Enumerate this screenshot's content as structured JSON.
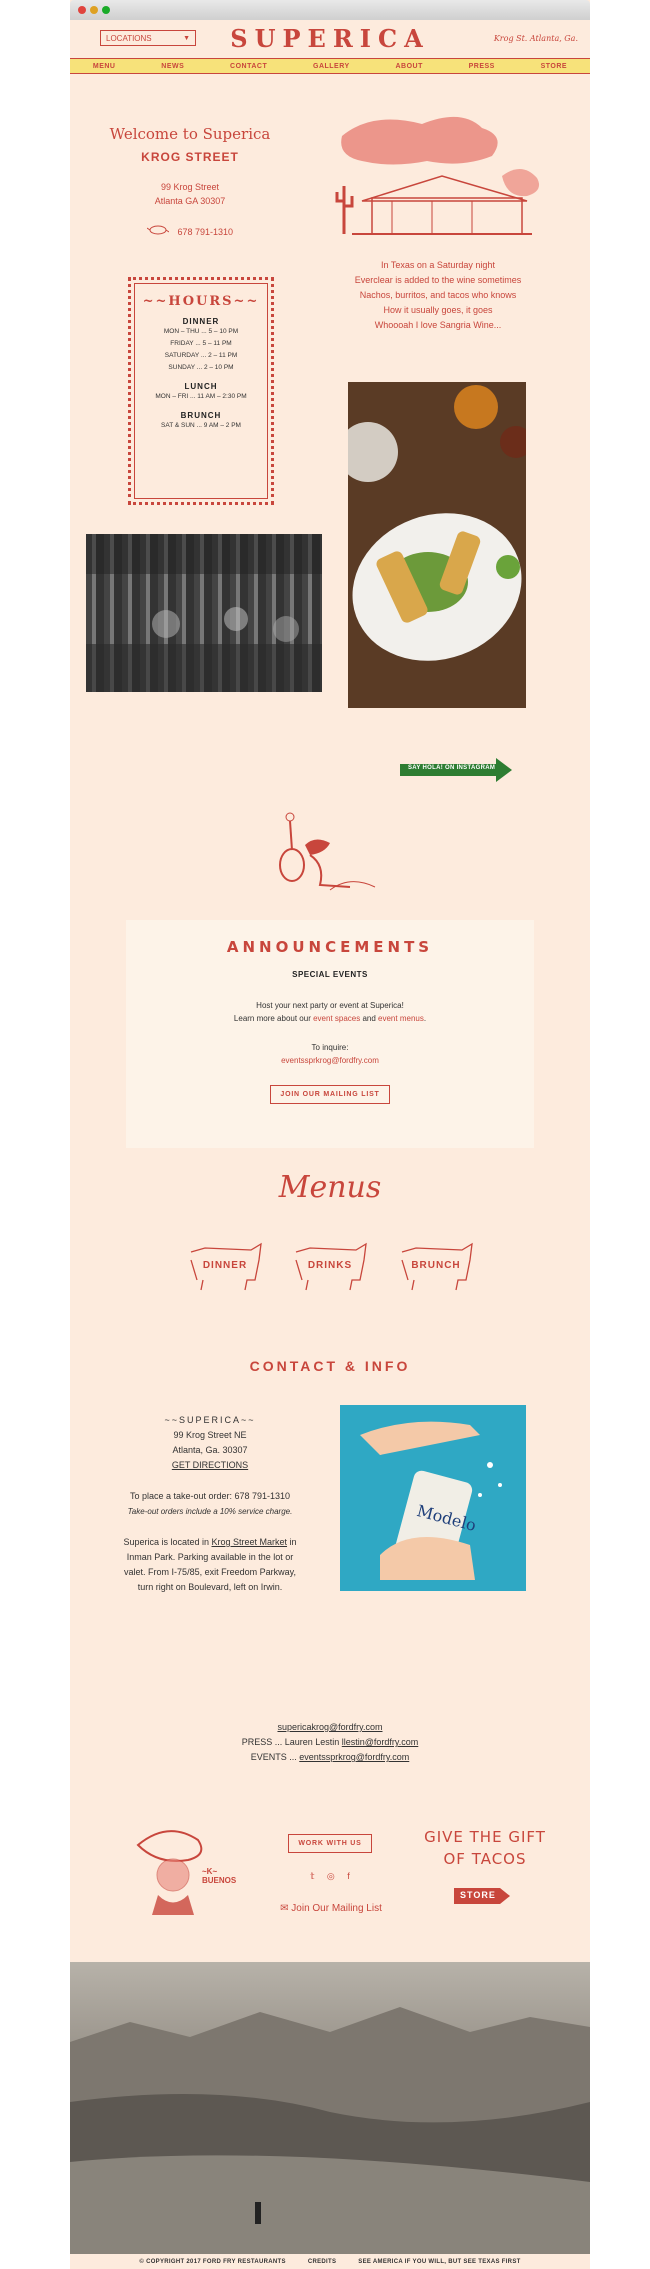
{
  "header": {
    "locations_label": "LOCATIONS",
    "logo": "SUPERICA",
    "tagline": "Krog St. Atlanta, Ga.",
    "nav": [
      "MENU",
      "NEWS",
      "CONTACT",
      "GALLERY",
      "ABOUT",
      "PRESS",
      "STORE"
    ]
  },
  "intro": {
    "welcome": "Welcome to Superica",
    "location": "KROG STREET",
    "address_line1": "99 Krog Street",
    "address_line2": "Atlanta GA 30307",
    "phone": "678 791-1310"
  },
  "hours": {
    "title": "~~HOURS~~",
    "dinner_label": "DINNER",
    "dinner": [
      "MON – THU ... 5 – 10 PM",
      "FRIDAY ... 5 – 11 PM",
      "SATURDAY ... 2 – 11 PM",
      "SUNDAY ... 2 – 10 PM"
    ],
    "lunch_label": "LUNCH",
    "lunch": [
      "MON – FRI ... 11 AM – 2:30 PM"
    ],
    "brunch_label": "BRUNCH",
    "brunch": [
      "SAT & SUN ... 9 AM – 2 PM"
    ]
  },
  "poem": [
    "In Texas on a Saturday night",
    "Everclear is added to the wine sometimes",
    "Nachos, burritos, and tacos who knows",
    "How it usually goes, it goes",
    "Whoooah I love Sangria Wine..."
  ],
  "instagram": "SAY HOLA! ON INSTAGRAM",
  "announcements": {
    "title": "ANNOUNCEMENTS",
    "subtitle": "SPECIAL EVENTS",
    "line1": "Host your next party or event at Superica!",
    "line2_pre": "Learn more about our ",
    "link1": "event spaces",
    "line2_mid": " and ",
    "link2": "event menus",
    "line2_end": ".",
    "inquire": "To inquire:",
    "email": "eventssprkrog@fordfry.com",
    "button": "JOIN OUR MAILING LIST"
  },
  "menus": {
    "title": "Menus",
    "items": [
      "DINNER",
      "DRINKS",
      "BRUNCH"
    ]
  },
  "contact": {
    "title": "CONTACT & INFO",
    "name": "~~SUPERICA~~",
    "street": "99 Krog Street NE",
    "city": "Atlanta, Ga. 30307",
    "directions": "GET DIRECTIONS",
    "takeout": "To place a take-out order:   678 791-1310",
    "takeout_note": "Take-out orders include a 10% service charge.",
    "loc_pre": "Superica is located in ",
    "loc_link": "Krog Street Market",
    "loc_post": " in Inman Park. Parking available in the lot or valet. From I-75/85, exit Freedom Parkway, turn right on Boulevard, left on Irwin.",
    "email_main": "supericakrog@fordfry.com",
    "press_label": "PRESS ... Lauren Lestin ",
    "press_email": "llestin@fordfry.com",
    "events_label": "EVENTS ... ",
    "events_email": "eventssprkrog@fordfry.com"
  },
  "footer_promo": {
    "work_button": "WORK WITH US",
    "mailing": "Join Our Mailing List",
    "gift_line1": "GIVE THE GIFT",
    "gift_line2": "OF TACOS",
    "store_button": "STORE",
    "sticker_text": "~K~ BUENOS"
  },
  "footer": {
    "copyright": "© COPYRIGHT 2017 FORD FRY RESTAURANTS",
    "credits": "CREDITS",
    "slogan": "SEE AMERICA IF YOU WILL, BUT SEE TEXAS FIRST"
  },
  "colors": {
    "accent": "#c8463c",
    "background": "#fdebdd",
    "nav_bar": "#f7e27a"
  }
}
